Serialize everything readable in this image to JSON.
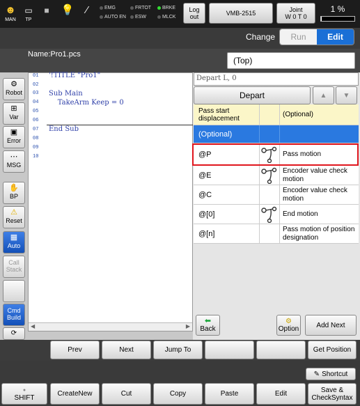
{
  "topbar": {
    "icons": [
      {
        "name": "man-icon",
        "label": "MAN"
      },
      {
        "name": "tp-icon",
        "label": "TP"
      },
      {
        "name": "stop-square-icon",
        "label": ""
      },
      {
        "name": "bulb-icon",
        "label": ""
      },
      {
        "name": "tool-icon",
        "label": ""
      }
    ],
    "indicators": [
      {
        "label": "EMG",
        "on": false
      },
      {
        "label": "AUTO EN",
        "on": false
      },
      {
        "label": "FRTOT",
        "on": false
      },
      {
        "label": "ESW",
        "on": false
      },
      {
        "label": "BRKE",
        "on": true
      },
      {
        "label": "MLCK",
        "on": false
      }
    ],
    "logout": "Log out",
    "robot_model": "VMB-2515",
    "joint_label": "Joint",
    "joint_value": "W 0 T 0",
    "speed": "1 %",
    "speed_fraction": 0.01
  },
  "header": {
    "change_label": "Change",
    "run": "Run",
    "edit": "Edit",
    "name": "Name:Pro1.pcs",
    "location": "(Top)"
  },
  "sidebar": {
    "robot": "Robot",
    "var": "Var",
    "error": "Error",
    "msg": "MSG",
    "bp": "BP",
    "reset": "Reset",
    "auto": "Auto",
    "call_stack": "Call Stack",
    "cmd_build": "Cmd Build"
  },
  "editor": {
    "lines": [
      {
        "no": "01",
        "text": "'!TITLE \"Pro1\""
      },
      {
        "no": "02",
        "text": ""
      },
      {
        "no": "03",
        "text": "Sub Main"
      },
      {
        "no": "04",
        "text": "    TakeArm Keep = 0"
      },
      {
        "no": "05",
        "text": ""
      },
      {
        "no": "06",
        "text": ""
      },
      {
        "no": "07",
        "text": "End Sub"
      },
      {
        "no": "08",
        "text": ""
      },
      {
        "no": "09",
        "text": ""
      },
      {
        "no": "10",
        "text": ""
      }
    ]
  },
  "command": {
    "field": "Depart L, 0",
    "name": "Depart",
    "up_icon": "arrow-up-icon",
    "down_icon": "arrow-down-icon",
    "header_col1": "Pass start displacement",
    "header_col3": "(Optional)",
    "selected": "(Optional)",
    "options": [
      {
        "key": "@P",
        "desc": "Pass motion",
        "icon": "pass-motion-icon",
        "highlight": true
      },
      {
        "key": "@E",
        "desc": "Encoder value check motion",
        "icon": "encoder-motion-icon",
        "highlight": false
      },
      {
        "key": "@C",
        "desc": "Encoder value check motion",
        "icon": "",
        "highlight": false
      },
      {
        "key": "@[0]",
        "desc": "End motion",
        "icon": "end-motion-icon",
        "highlight": false
      },
      {
        "key": "@[n]",
        "desc": "Pass motion of position designation",
        "icon": "",
        "highlight": false
      }
    ],
    "back": "Back",
    "option": "Option",
    "add_next": "Add Next"
  },
  "navrow": {
    "prev": "Prev",
    "next": "Next",
    "jump_to": "Jump To",
    "get_position": "Get Position"
  },
  "footer": {
    "shortcut": "Shortcut",
    "shift": "SHIFT",
    "create_new": "CreateNew",
    "cut": "Cut",
    "copy": "Copy",
    "paste": "Paste",
    "edit": "Edit",
    "save": "Save & CheckSyntax"
  }
}
